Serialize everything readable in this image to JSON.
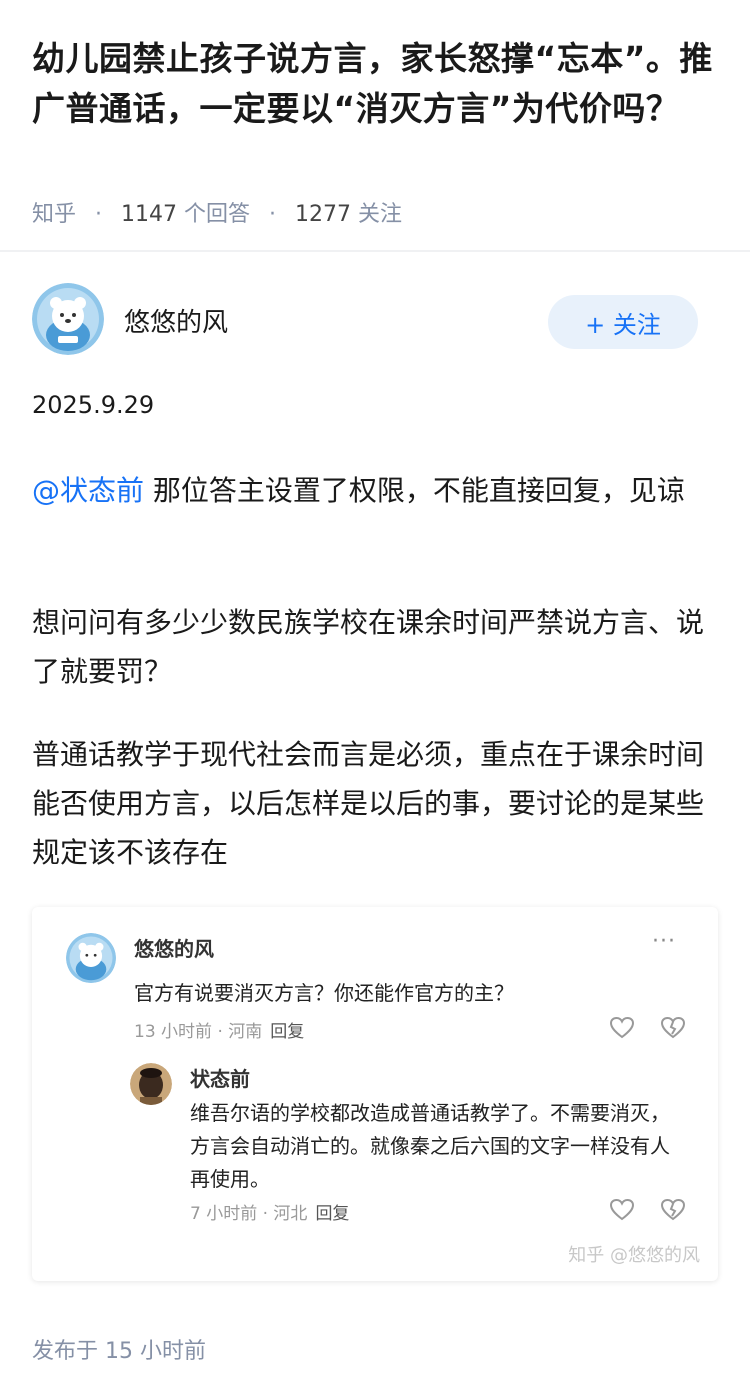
{
  "question": {
    "title": "幼儿园禁止孩子说方言，家长怒撑“忘本”。推广普通话，一定要以“消灭方言”为代价吗？",
    "source": "知乎",
    "answer_count": "1147",
    "answer_suffix": "个回答",
    "follow_count": "1277",
    "follow_suffix": "关注"
  },
  "answer": {
    "author": "悠悠的风",
    "follow_button": "+ 关注",
    "date": "2025.9.29",
    "mention": "@状态前",
    "paragraph1_rest": " 那位答主设置了权限，不能直接回复，见谅",
    "paragraph2": "想问问有多少少数民族学校在课余时间严禁说方言、说了就要罚？",
    "paragraph3": "普通话教学于现代社会而言是必须，重点在于课余时间能否使用方言，以后怎样是以后的事，要讨论的是某些规定该不该存在",
    "published": "发布于  15 小时前"
  },
  "screenshot": {
    "comment": {
      "author": "悠悠的风",
      "text": "官方有说要消灭方言？你还能作官方的主？",
      "meta": "13 小时前 · 河南",
      "reply_label": "回复"
    },
    "reply": {
      "author": "状态前",
      "text": "维吾尔语的学校都改造成普通话教学了。不需要消灭，方言会自动消亡的。就像秦之后六国的文字一样没有人再使用。",
      "meta": "7 小时前 · 河北",
      "reply_label": "回复"
    },
    "watermark": "知乎 @悠悠的风",
    "more": "···"
  },
  "colors": {
    "accent": "#1772f6",
    "meta_gray": "#8590a6",
    "follow_bg": "#e8f1fb"
  },
  "icons": [
    "avatar-bear-icon",
    "avatar-photo",
    "heart-icon",
    "broken-heart-icon",
    "more-icon"
  ]
}
